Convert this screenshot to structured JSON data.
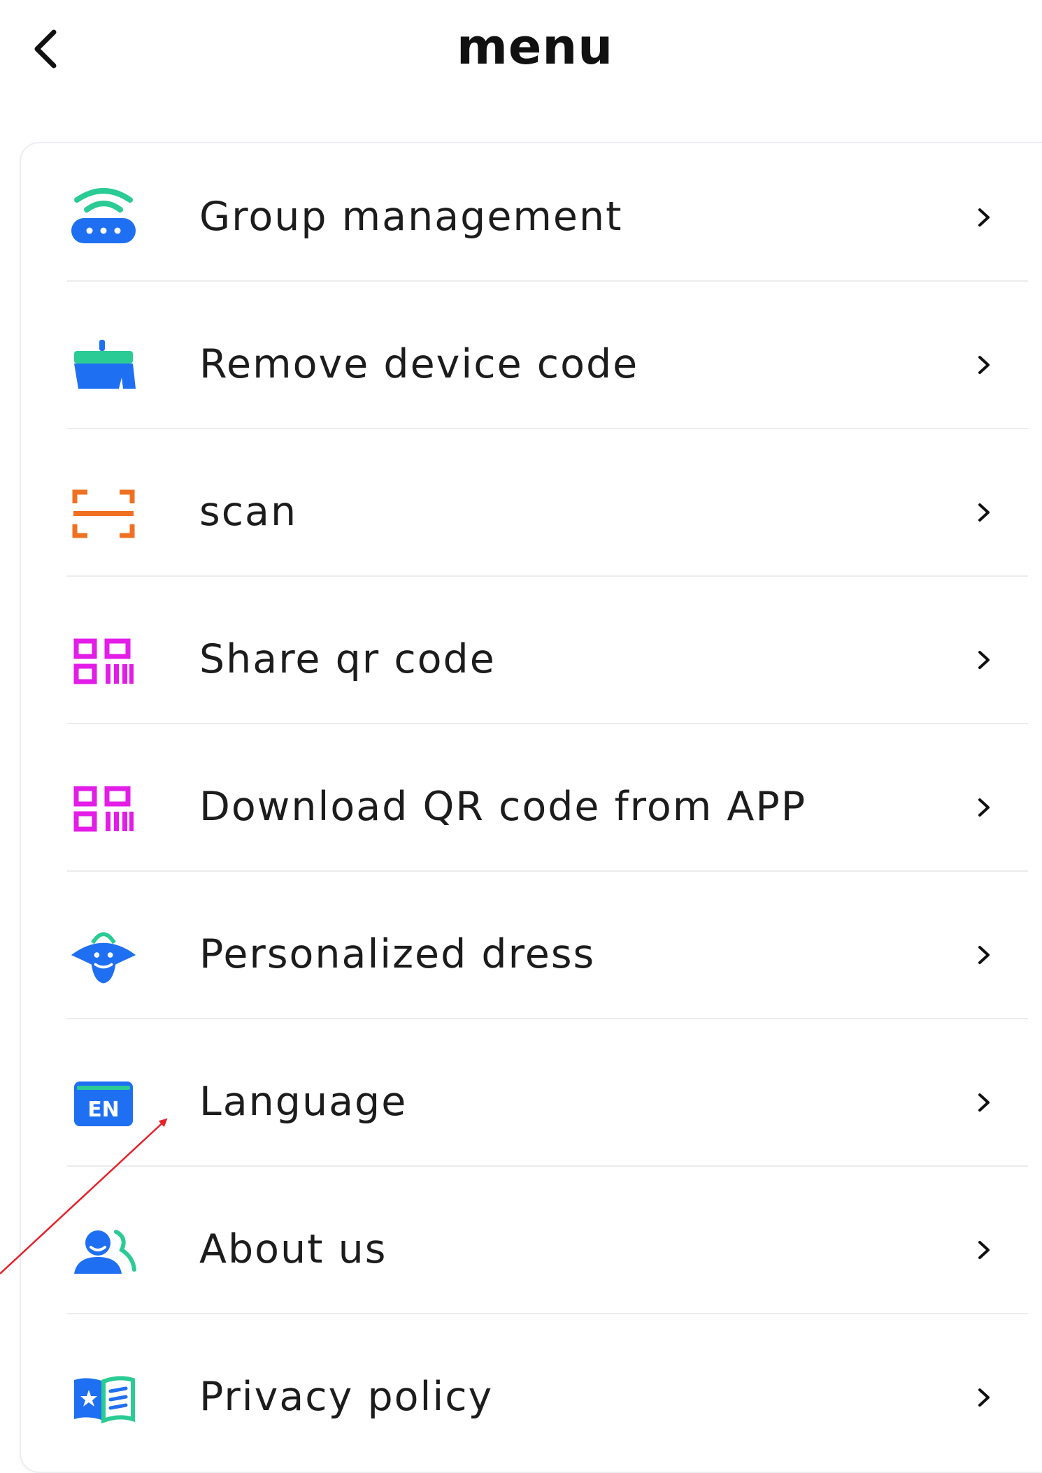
{
  "header": {
    "title": "menu",
    "back_icon": "chevron-left-icon"
  },
  "menu": {
    "items": [
      {
        "label": "Group management",
        "icon": "router-icon"
      },
      {
        "label": "Remove device code",
        "icon": "broom-icon"
      },
      {
        "label": "scan",
        "icon": "scan-icon"
      },
      {
        "label": "Share qr code",
        "icon": "qr-code-icon"
      },
      {
        "label": "Download QR code from APP",
        "icon": "qr-code-icon"
      },
      {
        "label": "Personalized dress",
        "icon": "mascot-icon"
      },
      {
        "label": "Language",
        "icon": "language-en-icon",
        "icon_text": "EN"
      },
      {
        "label": "About us",
        "icon": "users-icon"
      },
      {
        "label": "Privacy policy",
        "icon": "book-icon"
      }
    ]
  },
  "colors": {
    "blue": "#1f6ff2",
    "green": "#2bcb95",
    "orange": "#f07022",
    "magenta": "#e31ce8",
    "annotation_red": "#e8202a"
  }
}
